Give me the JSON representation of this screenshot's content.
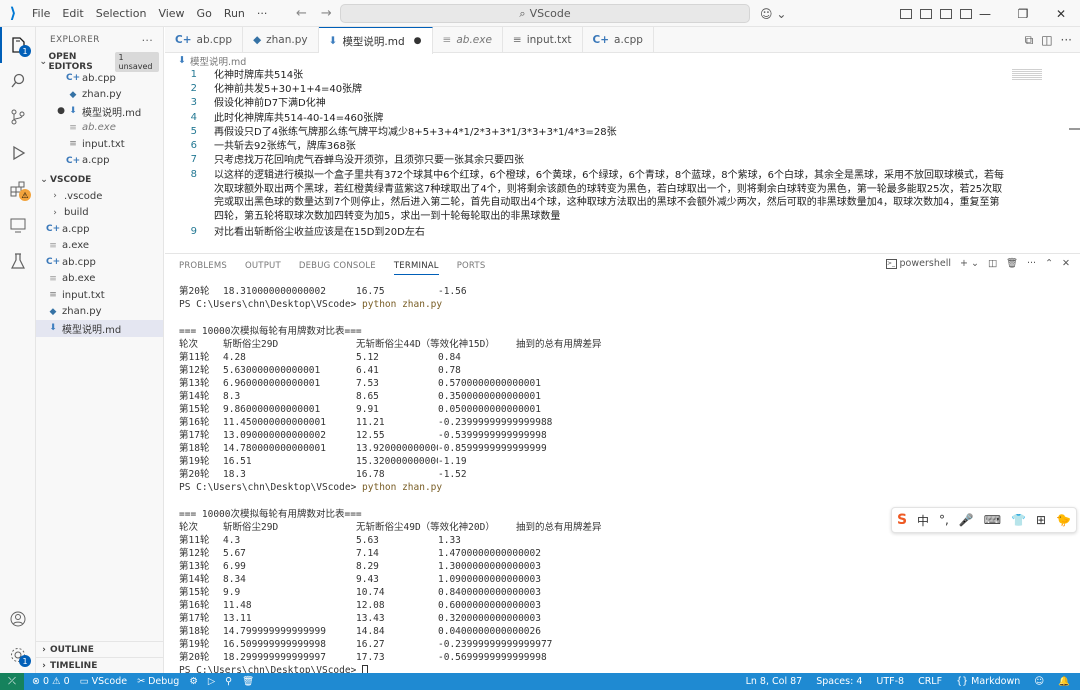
{
  "menu": [
    "File",
    "Edit",
    "Selection",
    "View",
    "Go",
    "Run",
    "···"
  ],
  "search": "VScode",
  "sidebar": {
    "title": "EXPLORER",
    "open_editors": {
      "label": "OPEN EDITORS",
      "badge": "1 unsaved",
      "items": [
        {
          "name": "ab.cpp",
          "icon": "cpp-icon",
          "modified": false
        },
        {
          "name": "zhan.py",
          "icon": "py-icon",
          "modified": false
        },
        {
          "name": "模型说明.md",
          "icon": "md-icon",
          "modified": true
        },
        {
          "name": "ab.exe",
          "icon": "exe-icon",
          "modified": false
        },
        {
          "name": "input.txt",
          "icon": "txt-icon",
          "modified": false
        },
        {
          "name": "a.cpp",
          "icon": "cpp-icon",
          "modified": false
        }
      ]
    },
    "workspace": {
      "label": "VSCODE",
      "items": [
        {
          "name": ".vscode",
          "icon": "folder-icon"
        },
        {
          "name": "build",
          "icon": "folder-icon"
        },
        {
          "name": "a.cpp",
          "icon": "cpp-icon"
        },
        {
          "name": "a.exe",
          "icon": "exe-icon"
        },
        {
          "name": "ab.cpp",
          "icon": "cpp-icon"
        },
        {
          "name": "ab.exe",
          "icon": "exe-icon"
        },
        {
          "name": "input.txt",
          "icon": "txt-icon"
        },
        {
          "name": "zhan.py",
          "icon": "py-icon"
        },
        {
          "name": "模型说明.md",
          "icon": "md-icon"
        }
      ]
    },
    "outline": "OUTLINE",
    "timeline": "TIMELINE"
  },
  "activity_badges": {
    "explorer": "1",
    "extensions": "⚠"
  },
  "tabs": [
    {
      "label": "ab.cpp",
      "icon": "cpp-icon"
    },
    {
      "label": "zhan.py",
      "icon": "py-icon"
    },
    {
      "label": "模型说明.md",
      "icon": "md-icon",
      "active": true,
      "modified": "●"
    },
    {
      "label": "ab.exe",
      "icon": "exe-icon"
    },
    {
      "label": "input.txt",
      "icon": "txt-icon"
    },
    {
      "label": "a.cpp",
      "icon": "cpp-icon"
    }
  ],
  "breadcrumb": "模型说明.md",
  "editor_lines": [
    {
      "n": "1",
      "text": "化神时牌库共514张"
    },
    {
      "n": "2",
      "text": "化神前共发5+30+1+4=40张牌"
    },
    {
      "n": "3",
      "text": "假设化神前D7下满D化神"
    },
    {
      "n": "4",
      "text": "此时化神牌库共514-40-14=460张牌"
    },
    {
      "n": "5",
      "text": "再假设只D了4张练气牌那么练气牌平均减少8+5+3+4*1/2*3+3*1/3*3+3*1/4*3=28张"
    },
    {
      "n": "6",
      "text": "一共斩去92张练气，牌库368张"
    },
    {
      "n": "7",
      "text": "只考虑找万花回响虎气吞蝉鸟没开须弥，且须弥只要一张其余只要四张"
    },
    {
      "n": "8",
      "text": "以这样的逻辑进行模拟一个盒子里共有372个球其中6个红球，6个橙球，6个黄球，6个绿球，6个青球，8个蓝球，8个紫球，6个白球，其余全是黑球，采用不放回取球模式，若每次取球额外取出两个黑球，若红橙黄绿青蓝紫这7种球取出了4个，则将剩余该颜色的球转变为黑色，若白球取出一个，则将剩余白球转变为黑色，第一轮最多能取25次，若25次取完或取出黑色球的数量达到7个则停止，然后进入第二轮，首先自动取出4个球，这种取球方法取出的黑球不会额外减少两次，然后可取的非黑球数量加4，取球次数加4，重复至第四轮，第五轮将取球次数加四转变为加5，求出一到十轮每轮取出的非黑球数量"
    },
    {
      "n": "9",
      "text": "对比看出斩断俗尘收益应该是在15D到20D左右"
    }
  ],
  "panel": {
    "tabs": [
      "PROBLEMS",
      "OUTPUT",
      "DEBUG CONSOLE",
      "TERMINAL",
      "PORTS"
    ],
    "active_tab": "TERMINAL",
    "shell": "powershell"
  },
  "terminal": {
    "top_row": {
      "c1": "第20轮",
      "c2": "18.310000000000002",
      "c3": "16.75",
      "c4": "-1.56"
    },
    "prompt": "PS C:\\Users\\chn\\Desktop\\VScode>",
    "command": "python zhan.py",
    "runs": [
      {
        "title": "=== 10000次模拟每轮有用牌数对比表===",
        "header": [
          "轮次",
          "斩断俗尘29D",
          "无斩断俗尘44D（等效化神15D）",
          "抽到的总有用牌差异"
        ],
        "rows": [
          [
            "第11轮",
            "4.28",
            "5.12",
            "0.84"
          ],
          [
            "第12轮",
            "5.630000000000001",
            "6.41",
            "0.78"
          ],
          [
            "第13轮",
            "6.960000000000001",
            "7.53",
            "0.5700000000000001"
          ],
          [
            "第14轮",
            "8.3",
            "8.65",
            "0.3500000000000001"
          ],
          [
            "第15轮",
            "9.860000000000001",
            "9.91",
            "0.0500000000000001"
          ],
          [
            "第16轮",
            "11.450000000000001",
            "11.21",
            "-0.23999999999999988"
          ],
          [
            "第17轮",
            "13.090000000000002",
            "12.55",
            "-0.5399999999999998"
          ],
          [
            "第18轮",
            "14.780000000000001",
            "13.920000000000002",
            "-0.8599999999999999"
          ],
          [
            "第19轮",
            "16.51",
            "15.320000000000002",
            "-1.19"
          ],
          [
            "第20轮",
            "18.3",
            "16.78",
            "-1.52"
          ]
        ]
      },
      {
        "title": "=== 10000次模拟每轮有用牌数对比表===",
        "header": [
          "轮次",
          "斩断俗尘29D",
          "无斩断俗尘49D（等效化神20D）",
          "抽到的总有用牌差异"
        ],
        "rows": [
          [
            "第11轮",
            "4.3",
            "5.63",
            "1.33"
          ],
          [
            "第12轮",
            "5.67",
            "7.14",
            "1.4700000000000002"
          ],
          [
            "第13轮",
            "6.99",
            "8.29",
            "1.3000000000000003"
          ],
          [
            "第14轮",
            "8.34",
            "9.43",
            "1.0900000000000003"
          ],
          [
            "第15轮",
            "9.9",
            "10.74",
            "0.8400000000000003"
          ],
          [
            "第16轮",
            "11.48",
            "12.08",
            "0.6000000000000003"
          ],
          [
            "第17轮",
            "13.11",
            "13.43",
            "0.3200000000000003"
          ],
          [
            "第18轮",
            "14.799999999999999",
            "14.84",
            "0.0400000000000026"
          ],
          [
            "第19轮",
            "16.509999999999998",
            "16.27",
            "-0.23999999999999977"
          ],
          [
            "第20轮",
            "18.299999999999997",
            "17.73",
            "-0.5699999999999998"
          ]
        ]
      }
    ]
  },
  "ime": [
    "中",
    "°,",
    "🎤",
    "⌨",
    "👕",
    "⊞"
  ],
  "statusbar": {
    "left": [
      "⊗ 0 ⚠ 0",
      "VScode",
      "Debug"
    ],
    "right": [
      "Ln 8, Col 87",
      "Spaces: 4",
      "UTF-8",
      "CRLF",
      "{} Markdown"
    ]
  },
  "colors": {
    "accent": "#005fb8",
    "statusbar": "#1f8ad2"
  }
}
